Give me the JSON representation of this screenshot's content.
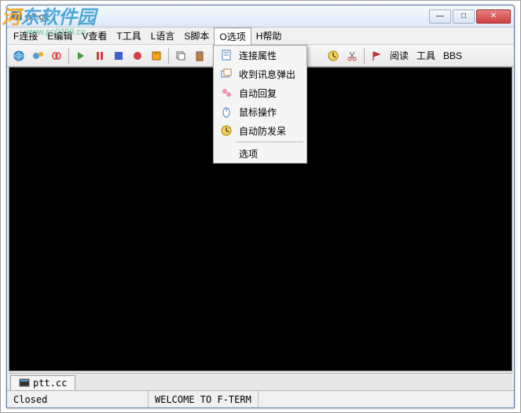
{
  "watermark": {
    "line1_a": "河",
    "line1_b": "东软件园",
    "line2": "www.pc0359.cn"
  },
  "window": {
    "title": "ptt.cc"
  },
  "titlebar_buttons": {
    "min": "—",
    "max": "□",
    "close": "✕"
  },
  "menu": {
    "items": [
      "F连接",
      "E编辑",
      "V查看",
      "T工具",
      "L语言",
      "S脚本",
      "O选项",
      "H帮助"
    ]
  },
  "dropdown": {
    "items": [
      {
        "label": "连接属性",
        "icon": "doc"
      },
      {
        "label": "收到讯息弹出",
        "icon": "popup"
      },
      {
        "label": "自动回复",
        "icon": "chat"
      },
      {
        "label": "鼠标操作",
        "icon": "mouse"
      },
      {
        "label": "自动防发呆",
        "icon": "clock"
      }
    ],
    "last": "选项"
  },
  "toolbar_text": {
    "read": "阅读",
    "tools": "工具",
    "bbs": "BBS"
  },
  "tab": {
    "label": "ptt.cc"
  },
  "status": {
    "left": "Closed",
    "center": "WELCOME TO F-TERM"
  }
}
